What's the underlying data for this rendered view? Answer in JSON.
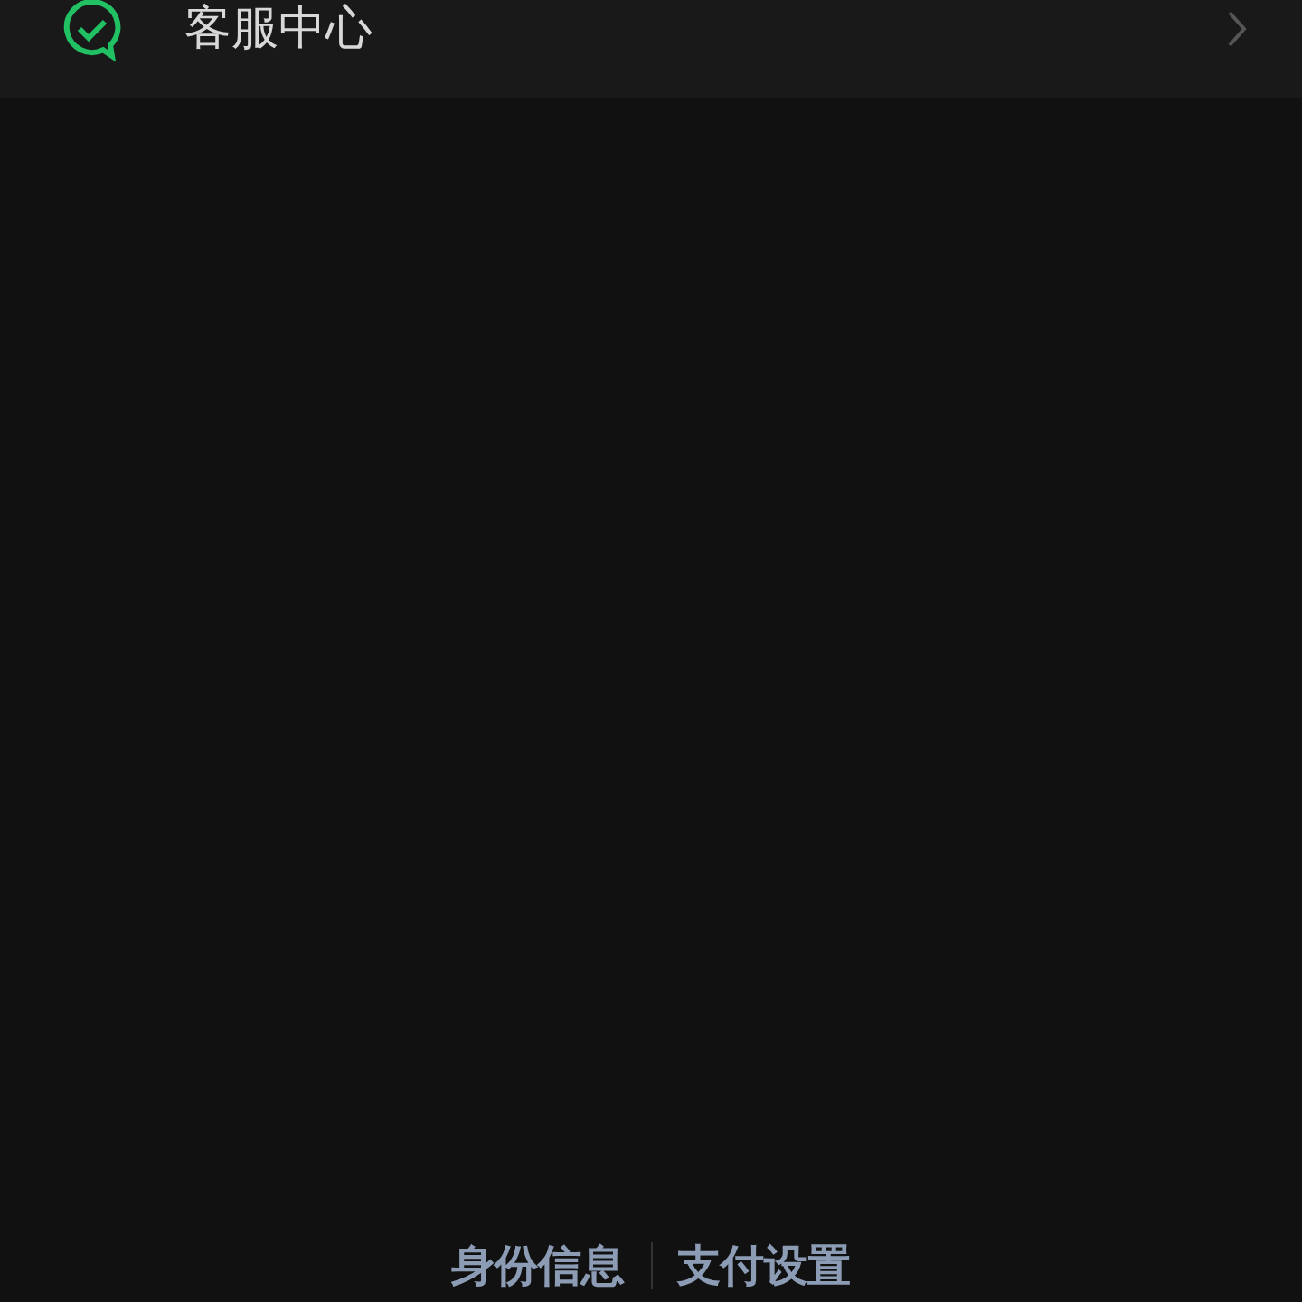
{
  "menu_item": {
    "label": "客服中心"
  },
  "footer_links": [
    "身份信息",
    "支付设置"
  ]
}
